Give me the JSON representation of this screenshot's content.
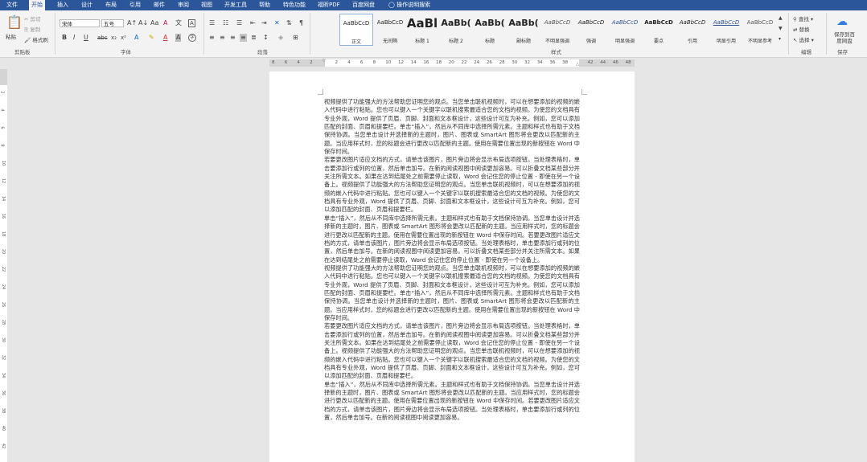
{
  "tabs": [
    {
      "label": "文件"
    },
    {
      "label": "开始",
      "active": true
    },
    {
      "label": "插入"
    },
    {
      "label": "设计"
    },
    {
      "label": "布局"
    },
    {
      "label": "引用"
    },
    {
      "label": "邮件"
    },
    {
      "label": "审阅"
    },
    {
      "label": "视图"
    },
    {
      "label": "开发工具"
    },
    {
      "label": "帮助"
    },
    {
      "label": "特色功能"
    },
    {
      "label": "福昕PDF"
    },
    {
      "label": "百度网盘"
    }
  ],
  "tell_me": "操作说明搜索",
  "clipboard": {
    "paste": "粘贴",
    "cut": "剪切",
    "copy": "复制",
    "format_painter": "格式刷",
    "label": "剪贴板"
  },
  "font": {
    "name": "宋体",
    "size": "五号",
    "label": "字体"
  },
  "paragraph": {
    "label": "段落"
  },
  "styles": {
    "label": "样式",
    "items": [
      {
        "preview": "AaBbCcD",
        "name": "正文"
      },
      {
        "preview": "AaBbCcD",
        "name": "无间隔"
      },
      {
        "preview": "AaBl",
        "name": "标题 1"
      },
      {
        "preview": "AaBb(",
        "name": "标题 2"
      },
      {
        "preview": "AaBb(",
        "name": "标题"
      },
      {
        "preview": "AaBb(",
        "name": "副标题"
      },
      {
        "preview": "AaBbCcD",
        "name": "不明显强调"
      },
      {
        "preview": "AaBbCcD",
        "name": "强调"
      },
      {
        "preview": "AaBbCcD",
        "name": "明显强调"
      },
      {
        "preview": "AaBbCcD",
        "name": "要点"
      },
      {
        "preview": "AaBbCcD",
        "name": "引用"
      },
      {
        "preview": "AaBbCcD",
        "name": "明显引用"
      },
      {
        "preview": "AaBbCcD",
        "name": "不明显参考"
      }
    ]
  },
  "editing": {
    "find": "查找",
    "replace": "替换",
    "select": "选择",
    "label": "编辑"
  },
  "save_group": {
    "button": "保存到百度网盘",
    "label": "保存"
  },
  "ruler_numbers": [
    "8",
    "6",
    "4",
    "2",
    "",
    "2",
    "4",
    "6",
    "8",
    "10",
    "12",
    "14",
    "16",
    "18",
    "20",
    "22",
    "24",
    "26",
    "28",
    "30",
    "32",
    "34",
    "36",
    "38",
    "",
    "42",
    "44",
    "46",
    "48"
  ],
  "vruler_numbers": [
    "2",
    "4",
    "6",
    "8",
    "10",
    "12",
    "14",
    "16",
    "18",
    "20",
    "22",
    "24",
    "26",
    "28",
    "30",
    "32",
    "34",
    "36",
    "38",
    "40",
    "42"
  ],
  "document": {
    "paragraphs": [
      "视频提供了功能强大的方法帮助您证明您的观点。当您单击联机视频时，可以在想要添加的视频的嵌入代码中进行粘贴。您也可以键入一个关键字以联机搜索最适合您的文档的视频。为使您的文档具有专业外观，Word 提供了页眉、页脚、封面和文本框设计，这些设计可互为补充。例如，您可以添加匹配的封面、页眉和提要栏。单击“插入”，然后从不同库中选择所需元素。主题和样式也有助于文档保持协调。当您单击设计并选择新的主题时，图片、图表或 SmartArt 图形将会更改以匹配新的主题。当应用样式时，您的标题会进行更改以匹配新的主题。使用在需要位置出现的新按钮在 Word 中保存时间。",
      "若要更改图片适应文档的方式，请单击该图片，图片旁边将会显示布局选项按钮。当处理表格时，单击要添加行或列的位置，然后单击加号。在新的阅读视图中阅读更加容易。可以折叠文档某些部分并关注所需文本。如果在达到结尾处之前需要停止读取，Word 会记住您的停止位置 - 即使在另一个设备上。视频提供了功能强大的方法帮助您证明您的观点。当您单击联机视频时，可以在想要添加的视频的嵌入代码中进行粘贴。您也可以键入一个关键字以联机搜索最适合您的文档的视频。为使您的文档具有专业外观，Word 提供了页眉、页脚、封面和文本框设计，这些设计可互为补充。例如，您可以添加匹配的封面、页眉和提要栏。",
      "单击“插入”，然后从不同库中选择所需元素。主题和样式也有助于文档保持协调。当您单击设计并选择新的主题时，图片、图表或 SmartArt 图形将会更改以匹配新的主题。当应用样式时，您的标题会进行更改以匹配新的主题。使用在需要位置出现的新按钮在 Word 中保存时间。若要更改图片适应文档的方式，请单击该图片，图片旁边将会显示布局选项按钮。当处理表格时，单击要添加行或列的位置，然后单击加号。在新的阅读视图中阅读更加容易。可以折叠文档某些部分并关注所需文本。如果在达到结尾处之前需要停止读取，Word 会记住您的停止位置 - 即使在另一个设备上。",
      "视频提供了功能强大的方法帮助您证明您的观点。当您单击联机视频时，可以在想要添加的视频的嵌入代码中进行粘贴。您也可以键入一个关键字以联机搜索最适合您的文档的视频。为使您的文档具有专业外观，Word 提供了页眉、页脚、封面和文本框设计，这些设计可互为补充。例如，您可以添加匹配的封面、页眉和提要栏。单击“插入”，然后从不同库中选择所需元素。主题和样式也有助于文档保持协调。当您单击设计并选择新的主题时，图片、图表或 SmartArt 图形将会更改以匹配新的主题。当应用样式时，您的标题会进行更改以匹配新的主题。使用在需要位置出现的新按钮在 Word 中保存时间。",
      "若要更改图片适应文档的方式，请单击该图片，图片旁边将会显示布局选项按钮。当处理表格时，单击要添加行或列的位置，然后单击加号。在新的阅读视图中阅读更加容易。可以折叠文档某些部分并关注所需文本。如果在达到结尾处之前需要停止读取，Word 会记住您的停止位置 - 即使在另一个设备上。视频提供了功能强大的方法帮助您证明您的观点。当您单击联机视频时，可以在想要添加的视频的嵌入代码中进行粘贴。您也可以键入一个关键字以联机搜索最适合您的文档的视频。为使您的文档具有专业外观，Word 提供了页眉、页脚、封面和文本框设计，这些设计可互为补充。例如，您可以添加匹配的封面、页眉和提要栏。",
      "单击“插入”，然后从不同库中选择所需元素。主题和样式也有助于文档保持协调。当您单击设计并选择新的主题时，图片、图表或 SmartArt 图形将会更改以匹配新的主题。当应用样式时，您的标题会进行更改以匹配新的主题。使用在需要位置出现的新按钮在 Word 中保存时间。若要更改图片适应文档的方式，请单击该图片，图片旁边将会显示布局选项按钮。当处理表格时，单击要添加行或列的位置，然后单击加号。在新的阅读视图中阅读更加容易。"
    ]
  }
}
